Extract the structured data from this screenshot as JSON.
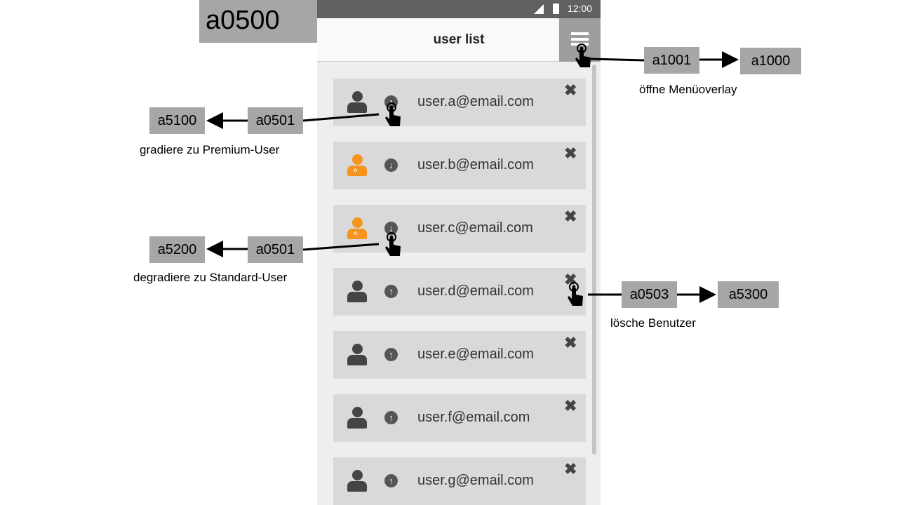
{
  "screen_id": "a0500",
  "status_bar": {
    "time": "12:00"
  },
  "app_bar": {
    "title": "user list"
  },
  "users": [
    {
      "email": "user.a@email.com",
      "premium": false,
      "role_icon": "up"
    },
    {
      "email": "user.b@email.com",
      "premium": true,
      "role_icon": "down"
    },
    {
      "email": "user.c@email.com",
      "premium": true,
      "role_icon": "down"
    },
    {
      "email": "user.d@email.com",
      "premium": false,
      "role_icon": "up"
    },
    {
      "email": "user.e@email.com",
      "premium": false,
      "role_icon": "up"
    },
    {
      "email": "user.f@email.com",
      "premium": false,
      "role_icon": "up"
    },
    {
      "email": "user.g@email.com",
      "premium": false,
      "role_icon": "up"
    }
  ],
  "annotations": {
    "menu": {
      "action": "a1001",
      "target": "a1000",
      "caption": "öffne Menüoverlay"
    },
    "upgrade": {
      "action": "a0501",
      "target": "a5100",
      "caption": "gradiere zu Premium-User"
    },
    "downgrade": {
      "action": "a0501",
      "target": "a5200",
      "caption": "degradiere zu Standard-User"
    },
    "delete": {
      "action": "a0503",
      "target": "a5300",
      "caption": "lösche Benutzer"
    }
  },
  "icons": {
    "delete": "close-icon",
    "menu": "hamburger-menu-icon",
    "tap": "tap-hand-icon",
    "avatar": "user-avatar-icon"
  },
  "colors": {
    "premium": "#f7941d",
    "standard": "#444444",
    "annotation_box": "#a6a6a6"
  }
}
